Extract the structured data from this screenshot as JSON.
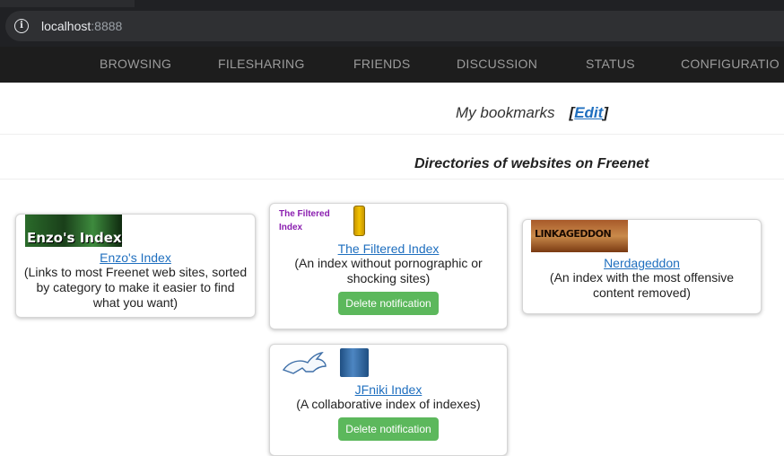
{
  "browser": {
    "host": "localhost",
    "port": ":8888"
  },
  "nav": [
    "BROWSING",
    "FILESHARING",
    "FRIENDS",
    "DISCUSSION",
    "STATUS",
    "CONFIGURATIO"
  ],
  "bookmarks": {
    "label": "My bookmarks",
    "open_bracket": "[",
    "edit": "Edit",
    "close_bracket": "]"
  },
  "section_title": "Directories of websites on Freenet",
  "cards": {
    "enzo": {
      "logo_text": "Enzo's Index",
      "title": "Enzo's Index",
      "desc": "(Links to most Freenet web sites, sorted by category to make it easier to find what you want)"
    },
    "filtered": {
      "logo_text": "The Filtered Index",
      "title": "The Filtered Index",
      "desc": "(An index without pornographic or shocking sites)",
      "button": "Delete notification"
    },
    "nerdageddon": {
      "logo_text": "LINKAGEDDON",
      "title": "Nerdageddon",
      "desc": "(An index with the most offensive content removed)"
    },
    "jfniki": {
      "title": "JFniki Index",
      "desc": "(A collaborative index of indexes)",
      "button": "Delete notification"
    }
  },
  "colors": {
    "link": "#1f6fbf",
    "button": "#5cb85c",
    "navbar": "#1d1d1d"
  }
}
